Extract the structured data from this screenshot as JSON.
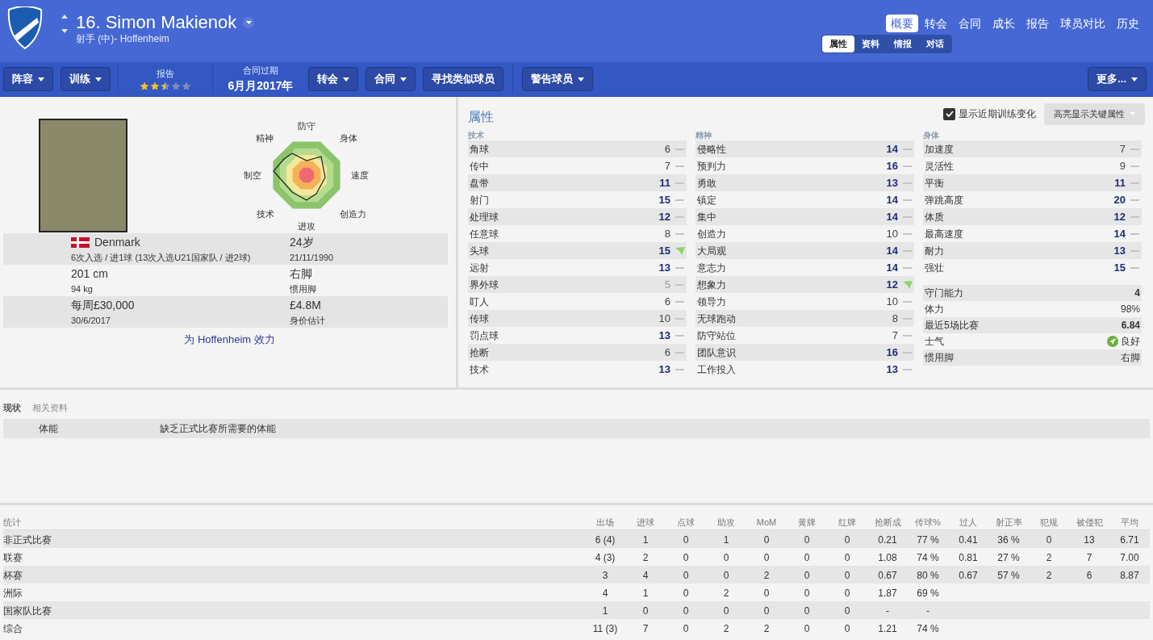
{
  "header": {
    "number_name": "16. Simon Makienok",
    "subtitle": "射手 (中)- Hoffenheim",
    "tabs": [
      {
        "label": "概要",
        "selected": true
      },
      {
        "label": "转会",
        "selected": false
      },
      {
        "label": "合同",
        "selected": false
      },
      {
        "label": "成长",
        "selected": false
      },
      {
        "label": "报告",
        "selected": false
      },
      {
        "label": "球员对比",
        "selected": false
      },
      {
        "label": "历史",
        "selected": false
      }
    ],
    "subtabs": [
      {
        "label": "属性",
        "selected": true
      },
      {
        "label": "资料",
        "selected": false
      },
      {
        "label": "情报",
        "selected": false
      },
      {
        "label": "对话",
        "selected": false
      }
    ]
  },
  "toolbar": {
    "buttons_left": [
      {
        "label": "阵容",
        "dropdown": true
      },
      {
        "label": "训练",
        "dropdown": true
      }
    ],
    "report": {
      "label": "报告",
      "stars": 2.5
    },
    "contract": {
      "label": "合同过期",
      "value": "6月月2017年"
    },
    "buttons_mid": [
      {
        "label": "转会",
        "dropdown": true
      },
      {
        "label": "合同",
        "dropdown": true
      },
      {
        "label": "寻找类似球员",
        "dropdown": false
      }
    ],
    "buttons_right": [
      {
        "label": "警告球员",
        "dropdown": true
      }
    ],
    "more": {
      "label": "更多...",
      "dropdown": true
    }
  },
  "profile": {
    "radar_labels": [
      "防守",
      "身体",
      "速度",
      "创造力",
      "进攻",
      "技术",
      "制空",
      "精神"
    ],
    "info": [
      {
        "main": "Denmark",
        "sub": "6次入选 / 进1球 (13次入选U21国家队 / 进2球)",
        "flag": true,
        "main2": "24岁",
        "sub2": "21/11/1990"
      },
      {
        "main": "201 cm",
        "sub": "94 kg",
        "flag": false,
        "main2": "右脚",
        "sub2": "惯用脚"
      },
      {
        "main": "每周£30,000",
        "sub": "30/6/2017",
        "flag": false,
        "main2": "£4.8M",
        "sub2": "身价估计"
      }
    ],
    "plays_for": "为 Hoffenheim 效力"
  },
  "attributes": {
    "title": "属性",
    "show_training": {
      "label": "显示近期训练变化",
      "checked": true
    },
    "highlight": "高亮显示关键属性",
    "groups": [
      {
        "title": "技术",
        "items": [
          {
            "name": "角球",
            "value": "6",
            "improving": false
          },
          {
            "name": "传中",
            "value": "7",
            "improving": false
          },
          {
            "name": "盘带",
            "value": "11",
            "improving": false
          },
          {
            "name": "射门",
            "value": "15",
            "improving": false
          },
          {
            "name": "处理球",
            "value": "12",
            "improving": false
          },
          {
            "name": "任意球",
            "value": "8",
            "improving": false
          },
          {
            "name": "头球",
            "value": "15",
            "improving": true
          },
          {
            "name": "远射",
            "value": "13",
            "improving": false
          },
          {
            "name": "界外球",
            "value": "5",
            "improving": false
          },
          {
            "name": "盯人",
            "value": "6",
            "improving": false
          },
          {
            "name": "传球",
            "value": "10",
            "improving": false
          },
          {
            "name": "罚点球",
            "value": "13",
            "improving": false
          },
          {
            "name": "抢断",
            "value": "6",
            "improving": false
          },
          {
            "name": "技术",
            "value": "13",
            "improving": false
          }
        ]
      },
      {
        "title": "精神",
        "items": [
          {
            "name": "侵略性",
            "value": "14",
            "improving": false
          },
          {
            "name": "预判力",
            "value": "16",
            "improving": false
          },
          {
            "name": "勇敢",
            "value": "13",
            "improving": false
          },
          {
            "name": "镇定",
            "value": "14",
            "improving": false
          },
          {
            "name": "集中",
            "value": "14",
            "improving": false
          },
          {
            "name": "创造力",
            "value": "10",
            "improving": false
          },
          {
            "name": "大局观",
            "value": "14",
            "improving": false
          },
          {
            "name": "意志力",
            "value": "14",
            "improving": false
          },
          {
            "name": "想象力",
            "value": "12",
            "improving": true
          },
          {
            "name": "领导力",
            "value": "10",
            "improving": false
          },
          {
            "name": "无球跑动",
            "value": "8",
            "improving": false
          },
          {
            "name": "防守站位",
            "value": "7",
            "improving": false
          },
          {
            "name": "团队意识",
            "value": "16",
            "improving": false
          },
          {
            "name": "工作投入",
            "value": "13",
            "improving": false
          }
        ]
      },
      {
        "title": "身体",
        "items": [
          {
            "name": "加速度",
            "value": "7",
            "improving": false
          },
          {
            "name": "灵活性",
            "value": "9",
            "improving": false
          },
          {
            "name": "平衡",
            "value": "11",
            "improving": false
          },
          {
            "name": "弹跳高度",
            "value": "20",
            "improving": false
          },
          {
            "name": "体质",
            "value": "12",
            "improving": false
          },
          {
            "name": "最高速度",
            "value": "14",
            "improving": false
          },
          {
            "name": "耐力",
            "value": "13",
            "improving": false
          },
          {
            "name": "强壮",
            "value": "15",
            "improving": false
          }
        ]
      }
    ],
    "extra": [
      {
        "name": "守门能力",
        "value": "4",
        "kind": "bold"
      },
      {
        "name": "体力",
        "value": "98%",
        "kind": "plain"
      },
      {
        "name": "最近5场比赛",
        "value": "6.84",
        "kind": "bold"
      },
      {
        "name": "士气",
        "value": "良好",
        "kind": "morale"
      },
      {
        "name": "惯用脚",
        "value": "右脚",
        "kind": "plain"
      }
    ]
  },
  "status": {
    "tabs": [
      {
        "label": "现状",
        "selected": true
      },
      {
        "label": "相关资料",
        "selected": false
      }
    ],
    "rows": [
      {
        "label": "体能",
        "text": "缺乏正式比赛所需要的体能"
      }
    ]
  },
  "stats": {
    "columns": [
      "统计",
      "出场",
      "进球",
      "点球",
      "助攻",
      "MoM",
      "黄牌",
      "红牌",
      "抢断成",
      "传球%",
      "过人",
      "射正率",
      "犯规",
      "被侵犯",
      "平均"
    ],
    "rows": [
      [
        "非正式比赛",
        "6 (4)",
        "1",
        "0",
        "1",
        "0",
        "0",
        "0",
        "0.21",
        "77 %",
        "0.41",
        "36 %",
        "0",
        "13",
        "6.71"
      ],
      [
        "联赛",
        "4 (3)",
        "2",
        "0",
        "0",
        "0",
        "0",
        "0",
        "1.08",
        "74 %",
        "0.81",
        "27 %",
        "2",
        "7",
        "7.00"
      ],
      [
        "杯赛",
        "3",
        "4",
        "0",
        "0",
        "2",
        "0",
        "0",
        "0.67",
        "80 %",
        "0.67",
        "57 %",
        "2",
        "6",
        "8.87"
      ],
      [
        "洲际",
        "4",
        "1",
        "0",
        "2",
        "0",
        "0",
        "0",
        "1.87",
        "69 %",
        null,
        null,
        null,
        null,
        null
      ],
      [
        "国家队比赛",
        "1",
        "0",
        "0",
        "0",
        "0",
        "0",
        "0",
        "-",
        "-",
        null,
        null,
        null,
        null,
        null
      ],
      [
        "综合",
        "11 (3)",
        "7",
        "0",
        "2",
        "2",
        "0",
        "0",
        "1.21",
        "74 %",
        null,
        null,
        null,
        null,
        null
      ]
    ]
  }
}
